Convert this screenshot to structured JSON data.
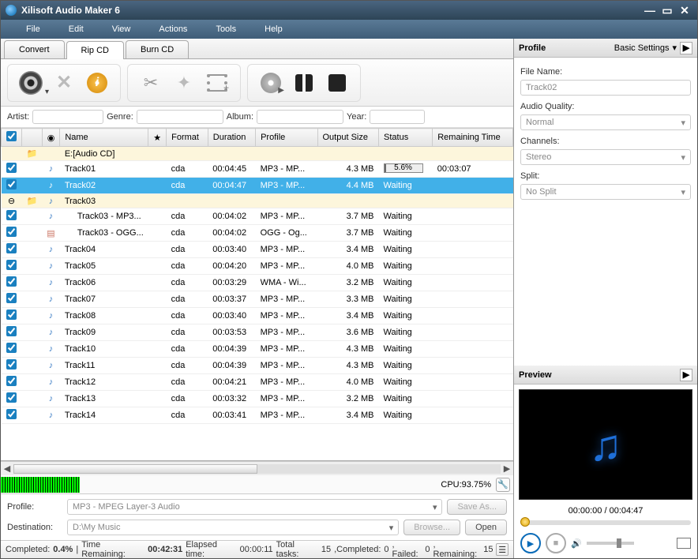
{
  "title": "Xilisoft Audio Maker 6",
  "menu": [
    "File",
    "Edit",
    "View",
    "Actions",
    "Tools",
    "Help"
  ],
  "tabs": {
    "convert": "Convert",
    "rip": "Rip CD",
    "burn": "Burn CD",
    "active": "rip"
  },
  "metadata": {
    "artist_label": "Artist:",
    "artist": "",
    "genre_label": "Genre:",
    "genre": "",
    "album_label": "Album:",
    "album": "",
    "year_label": "Year:",
    "year": ""
  },
  "columns": {
    "name": "Name",
    "star": "★",
    "format": "Format",
    "duration": "Duration",
    "profile": "Profile",
    "output_size": "Output Size",
    "status": "Status",
    "remaining": "Remaining Time"
  },
  "root_row": {
    "name": "E:[Audio CD]"
  },
  "rows": [
    {
      "checked": true,
      "icon": "audio",
      "name": "Track01",
      "format": "cda",
      "duration": "00:04:45",
      "profile": "MP3 - MP...",
      "size": "4.3 MB",
      "status_type": "progress",
      "progress": "5.6%",
      "percent": 5.6,
      "remaining": "00:03:07"
    },
    {
      "checked": true,
      "icon": "audio",
      "name": "Track02",
      "format": "cda",
      "duration": "00:04:47",
      "profile": "MP3 - MP...",
      "size": "4.4 MB",
      "status": "Waiting",
      "remaining": "",
      "selected": true
    },
    {
      "folder": true,
      "icon": "audio",
      "name": "Track03"
    },
    {
      "checked": true,
      "icon": "audio",
      "name": "Track03 - MP3...",
      "format": "cda",
      "duration": "00:04:02",
      "profile": "MP3 - MP...",
      "size": "3.7 MB",
      "status": "Waiting",
      "indent": true
    },
    {
      "checked": true,
      "icon": "file",
      "name": "Track03 - OGG...",
      "format": "cda",
      "duration": "00:04:02",
      "profile": "OGG - Og...",
      "size": "3.7 MB",
      "status": "Waiting",
      "indent": true
    },
    {
      "checked": true,
      "icon": "audio",
      "name": "Track04",
      "format": "cda",
      "duration": "00:03:40",
      "profile": "MP3 - MP...",
      "size": "3.4 MB",
      "status": "Waiting"
    },
    {
      "checked": true,
      "icon": "audio",
      "name": "Track05",
      "format": "cda",
      "duration": "00:04:20",
      "profile": "MP3 - MP...",
      "size": "4.0 MB",
      "status": "Waiting"
    },
    {
      "checked": true,
      "icon": "audio",
      "name": "Track06",
      "format": "cda",
      "duration": "00:03:29",
      "profile": "WMA - Wi...",
      "size": "3.2 MB",
      "status": "Waiting"
    },
    {
      "checked": true,
      "icon": "audio",
      "name": "Track07",
      "format": "cda",
      "duration": "00:03:37",
      "profile": "MP3 - MP...",
      "size": "3.3 MB",
      "status": "Waiting"
    },
    {
      "checked": true,
      "icon": "audio",
      "name": "Track08",
      "format": "cda",
      "duration": "00:03:40",
      "profile": "MP3 - MP...",
      "size": "3.4 MB",
      "status": "Waiting"
    },
    {
      "checked": true,
      "icon": "audio",
      "name": "Track09",
      "format": "cda",
      "duration": "00:03:53",
      "profile": "MP3 - MP...",
      "size": "3.6 MB",
      "status": "Waiting"
    },
    {
      "checked": true,
      "icon": "audio",
      "name": "Track10",
      "format": "cda",
      "duration": "00:04:39",
      "profile": "MP3 - MP...",
      "size": "4.3 MB",
      "status": "Waiting"
    },
    {
      "checked": true,
      "icon": "audio",
      "name": "Track11",
      "format": "cda",
      "duration": "00:04:39",
      "profile": "MP3 - MP...",
      "size": "4.3 MB",
      "status": "Waiting"
    },
    {
      "checked": true,
      "icon": "audio",
      "name": "Track12",
      "format": "cda",
      "duration": "00:04:21",
      "profile": "MP3 - MP...",
      "size": "4.0 MB",
      "status": "Waiting"
    },
    {
      "checked": true,
      "icon": "audio",
      "name": "Track13",
      "format": "cda",
      "duration": "00:03:32",
      "profile": "MP3 - MP...",
      "size": "3.2 MB",
      "status": "Waiting"
    },
    {
      "checked": true,
      "icon": "audio",
      "name": "Track14",
      "format": "cda",
      "duration": "00:03:41",
      "profile": "MP3 - MP...",
      "size": "3.4 MB",
      "status": "Waiting"
    }
  ],
  "cpu": {
    "label": "CPU:93.75%"
  },
  "bottom": {
    "profile_label": "Profile:",
    "profile_value": "MP3 - MPEG Layer-3 Audio",
    "destination_label": "Destination:",
    "destination_value": "D:\\My Music",
    "save_as": "Save As...",
    "browse": "Browse...",
    "open": "Open"
  },
  "status": {
    "completed_label": "Completed:",
    "completed_value": "0.4%",
    "time_remaining_label": "Time Remaining:",
    "time_remaining_value": "00:42:31",
    "elapsed_label": "Elapsed time:",
    "elapsed_value": "00:00:11",
    "total_tasks_label": "Total tasks:",
    "total_tasks_value": "15",
    "completed2_label": ",Completed:",
    "completed2_value": "0",
    "failed_label": ", Failed:",
    "failed_value": "0",
    "remaining_label": ", Remaining:",
    "remaining_value": "15"
  },
  "profile_panel": {
    "title": "Profile",
    "basic": "Basic Settings",
    "file_name_label": "File Name:",
    "file_name": "Track02",
    "quality_label": "Audio Quality:",
    "quality": "Normal",
    "channels_label": "Channels:",
    "channels": "Stereo",
    "split_label": "Split:",
    "split": "No Split"
  },
  "preview": {
    "title": "Preview",
    "time": "00:00:00 / 00:04:47"
  }
}
